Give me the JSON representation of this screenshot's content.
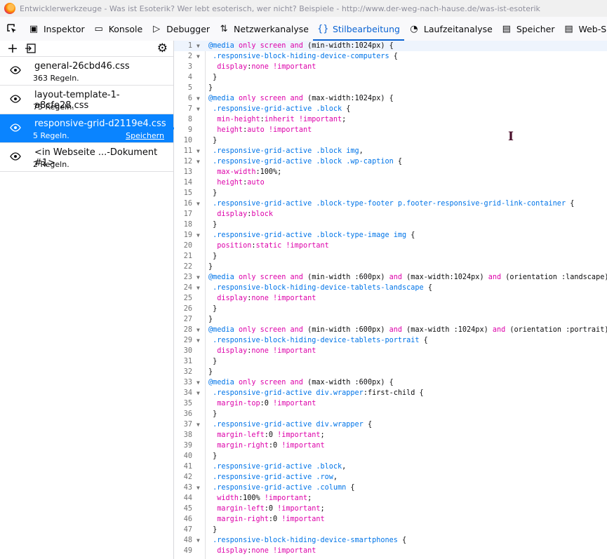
{
  "window": {
    "title": "Entwicklerwerkzeuge - Was ist Esoterik? Wer lebt esoterisch, wer nicht? Beispiele - http://www.der-weg-nach-hause.de/was-ist-esoterik"
  },
  "toolbar": {
    "tabs": [
      {
        "label": "Inspektor",
        "icon": "inspector-icon",
        "glyph": "▣"
      },
      {
        "label": "Konsole",
        "icon": "console-icon",
        "glyph": "▭"
      },
      {
        "label": "Debugger",
        "icon": "debugger-icon",
        "glyph": "▷"
      },
      {
        "label": "Netzwerkanalyse",
        "icon": "network-icon",
        "glyph": "⇅"
      },
      {
        "label": "Stilbearbeitung",
        "icon": "style-editor-icon",
        "glyph": "{}",
        "active": true
      },
      {
        "label": "Laufzeitanalyse",
        "icon": "performance-icon",
        "glyph": "◔"
      },
      {
        "label": "Speicher",
        "icon": "memory-icon",
        "glyph": "▤"
      },
      {
        "label": "Web-Speicher",
        "icon": "storage-icon",
        "glyph": "▤"
      }
    ]
  },
  "sidebar": {
    "stylesheets": [
      {
        "name": "general-26cbd46.css",
        "rules": "363 Regeln.",
        "selected": false
      },
      {
        "name": "layout-template-1-a8cfe28.css",
        "rules": "75 Regeln.",
        "selected": false
      },
      {
        "name": "responsive-grid-d2119e4.css",
        "rules": "5 Regeln.",
        "selected": true,
        "save": "Speichern"
      },
      {
        "name": "<in Webseite ...-Dokument #1>",
        "rules": "2 Regeln.",
        "selected": false
      }
    ]
  },
  "editor": {
    "cursor_line": 1,
    "lines": [
      [
        [
          "at",
          "@media "
        ],
        [
          "kw",
          "only screen and "
        ],
        [
          "p",
          "(min-width:1024px) {"
        ]
      ],
      [
        [
          "sel",
          " .responsive-block-hiding-device-computers "
        ],
        [
          "p",
          "{"
        ]
      ],
      [
        [
          "prop",
          "  display"
        ],
        [
          "p",
          ":"
        ],
        [
          "val",
          "none !important"
        ]
      ],
      [
        [
          "p",
          " }"
        ]
      ],
      [
        [
          "p",
          "}"
        ]
      ],
      [
        [
          "at",
          "@media "
        ],
        [
          "kw",
          "only screen and "
        ],
        [
          "p",
          "(max-width:1024px) {"
        ]
      ],
      [
        [
          "sel",
          " .responsive-grid-active .block "
        ],
        [
          "p",
          "{"
        ]
      ],
      [
        [
          "prop",
          "  min-height"
        ],
        [
          "p",
          ":"
        ],
        [
          "val",
          "inherit !important"
        ],
        [
          "p",
          ";"
        ]
      ],
      [
        [
          "prop",
          "  height"
        ],
        [
          "p",
          ":"
        ],
        [
          "val",
          "auto !important"
        ]
      ],
      [
        [
          "p",
          " }"
        ]
      ],
      [
        [
          "sel",
          " .responsive-grid-active .block img"
        ],
        [
          "p",
          ","
        ]
      ],
      [
        [
          "sel",
          " .responsive-grid-active .block .wp-caption "
        ],
        [
          "p",
          "{"
        ]
      ],
      [
        [
          "prop",
          "  max-width"
        ],
        [
          "p",
          ":100%;"
        ]
      ],
      [
        [
          "prop",
          "  height"
        ],
        [
          "p",
          ":"
        ],
        [
          "val",
          "auto"
        ]
      ],
      [
        [
          "p",
          " }"
        ]
      ],
      [
        [
          "sel",
          " .responsive-grid-active .block-type-footer p.footer-responsive-grid-link-container "
        ],
        [
          "p",
          "{"
        ]
      ],
      [
        [
          "prop",
          "  display"
        ],
        [
          "p",
          ":"
        ],
        [
          "val",
          "block"
        ]
      ],
      [
        [
          "p",
          " }"
        ]
      ],
      [
        [
          "sel",
          " .responsive-grid-active .block-type-image img "
        ],
        [
          "p",
          "{"
        ]
      ],
      [
        [
          "prop",
          "  position"
        ],
        [
          "p",
          ":"
        ],
        [
          "val",
          "static !important"
        ]
      ],
      [
        [
          "p",
          " }"
        ]
      ],
      [
        [
          "p",
          "}"
        ]
      ],
      [
        [
          "at",
          "@media "
        ],
        [
          "kw",
          "only screen and "
        ],
        [
          "p",
          "(min-width :600px) "
        ],
        [
          "kw",
          "and "
        ],
        [
          "p",
          "(max-width:1024px) "
        ],
        [
          "kw",
          "and "
        ],
        [
          "p",
          "(orientation :landscape) {"
        ]
      ],
      [
        [
          "sel",
          " .responsive-block-hiding-device-tablets-landscape "
        ],
        [
          "p",
          "{"
        ]
      ],
      [
        [
          "prop",
          "  display"
        ],
        [
          "p",
          ":"
        ],
        [
          "val",
          "none !important"
        ]
      ],
      [
        [
          "p",
          " }"
        ]
      ],
      [
        [
          "p",
          "}"
        ]
      ],
      [
        [
          "at",
          "@media "
        ],
        [
          "kw",
          "only screen and "
        ],
        [
          "p",
          "(min-width :600px) "
        ],
        [
          "kw",
          "and "
        ],
        [
          "p",
          "(max-width :1024px) "
        ],
        [
          "kw",
          "and "
        ],
        [
          "p",
          "(orientation :portrait) {"
        ]
      ],
      [
        [
          "sel",
          " .responsive-block-hiding-device-tablets-portrait "
        ],
        [
          "p",
          "{"
        ]
      ],
      [
        [
          "prop",
          "  display"
        ],
        [
          "p",
          ":"
        ],
        [
          "val",
          "none !important"
        ]
      ],
      [
        [
          "p",
          " }"
        ]
      ],
      [
        [
          "p",
          "}"
        ]
      ],
      [
        [
          "at",
          "@media "
        ],
        [
          "kw",
          "only screen and "
        ],
        [
          "p",
          "(max-width :600px) {"
        ]
      ],
      [
        [
          "sel",
          " .responsive-grid-active div.wrapper"
        ],
        [
          "p",
          ":first-child {"
        ]
      ],
      [
        [
          "prop",
          "  margin-top"
        ],
        [
          "p",
          ":0 "
        ],
        [
          "val",
          "!important"
        ]
      ],
      [
        [
          "p",
          " }"
        ]
      ],
      [
        [
          "sel",
          " .responsive-grid-active div.wrapper "
        ],
        [
          "p",
          "{"
        ]
      ],
      [
        [
          "prop",
          "  margin-left"
        ],
        [
          "p",
          ":0 "
        ],
        [
          "val",
          "!important"
        ],
        [
          "p",
          ";"
        ]
      ],
      [
        [
          "prop",
          "  margin-right"
        ],
        [
          "p",
          ":0 "
        ],
        [
          "val",
          "!important"
        ]
      ],
      [
        [
          "p",
          " }"
        ]
      ],
      [
        [
          "sel",
          " .responsive-grid-active .block"
        ],
        [
          "p",
          ","
        ]
      ],
      [
        [
          "sel",
          " .responsive-grid-active .row"
        ],
        [
          "p",
          ","
        ]
      ],
      [
        [
          "sel",
          " .responsive-grid-active .column "
        ],
        [
          "p",
          "{"
        ]
      ],
      [
        [
          "prop",
          "  width"
        ],
        [
          "p",
          ":100% "
        ],
        [
          "val",
          "!important"
        ],
        [
          "p",
          ";"
        ]
      ],
      [
        [
          "prop",
          "  margin-left"
        ],
        [
          "p",
          ":0 "
        ],
        [
          "val",
          "!important"
        ],
        [
          "p",
          ";"
        ]
      ],
      [
        [
          "prop",
          "  margin-right"
        ],
        [
          "p",
          ":0 "
        ],
        [
          "val",
          "!important"
        ]
      ],
      [
        [
          "p",
          " }"
        ]
      ],
      [
        [
          "sel",
          " .responsive-block-hiding-device-smartphones "
        ],
        [
          "p",
          "{"
        ]
      ],
      [
        [
          "prop",
          "  display"
        ],
        [
          "p",
          ":"
        ],
        [
          "val",
          "none !important"
        ]
      ]
    ],
    "fold_lines": [
      1,
      2,
      6,
      7,
      11,
      12,
      16,
      19,
      23,
      24,
      28,
      29,
      33,
      34,
      37,
      43,
      48
    ]
  }
}
